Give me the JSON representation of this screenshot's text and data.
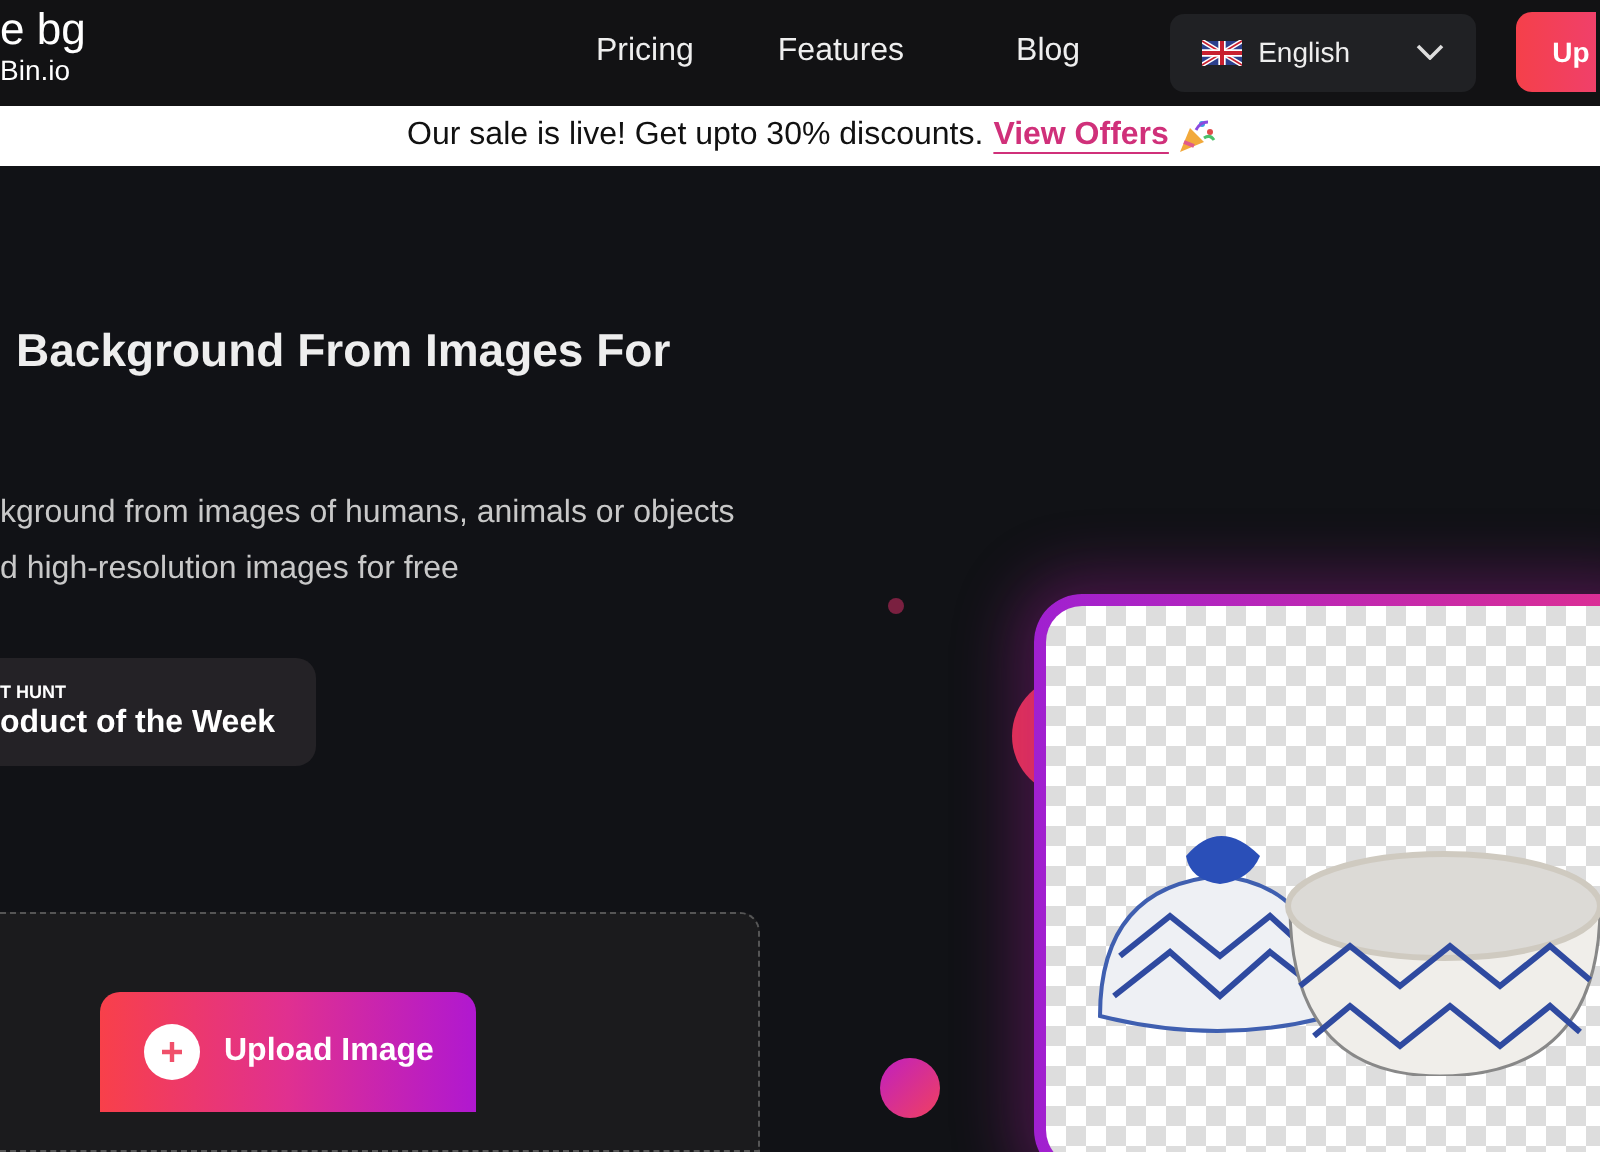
{
  "header": {
    "logo": {
      "title": "e bg",
      "subtitle": "Bin.io"
    },
    "nav": [
      {
        "label": "Pricing"
      },
      {
        "label": "Features"
      },
      {
        "label": "Blog"
      }
    ],
    "language": {
      "label": "English"
    },
    "upload_button": {
      "label": "Up"
    }
  },
  "banner": {
    "text": "Our sale is live! Get upto 30% discounts.",
    "link": "View Offers"
  },
  "hero": {
    "heading": "Background From Images For",
    "description": [
      "kground from images of humans, animals or objects",
      "d high-resolution images for free"
    ],
    "badge": {
      "eyebrow": "T HUNT",
      "title": "oduct of the Week"
    }
  },
  "upload": {
    "button": "Upload Image"
  }
}
